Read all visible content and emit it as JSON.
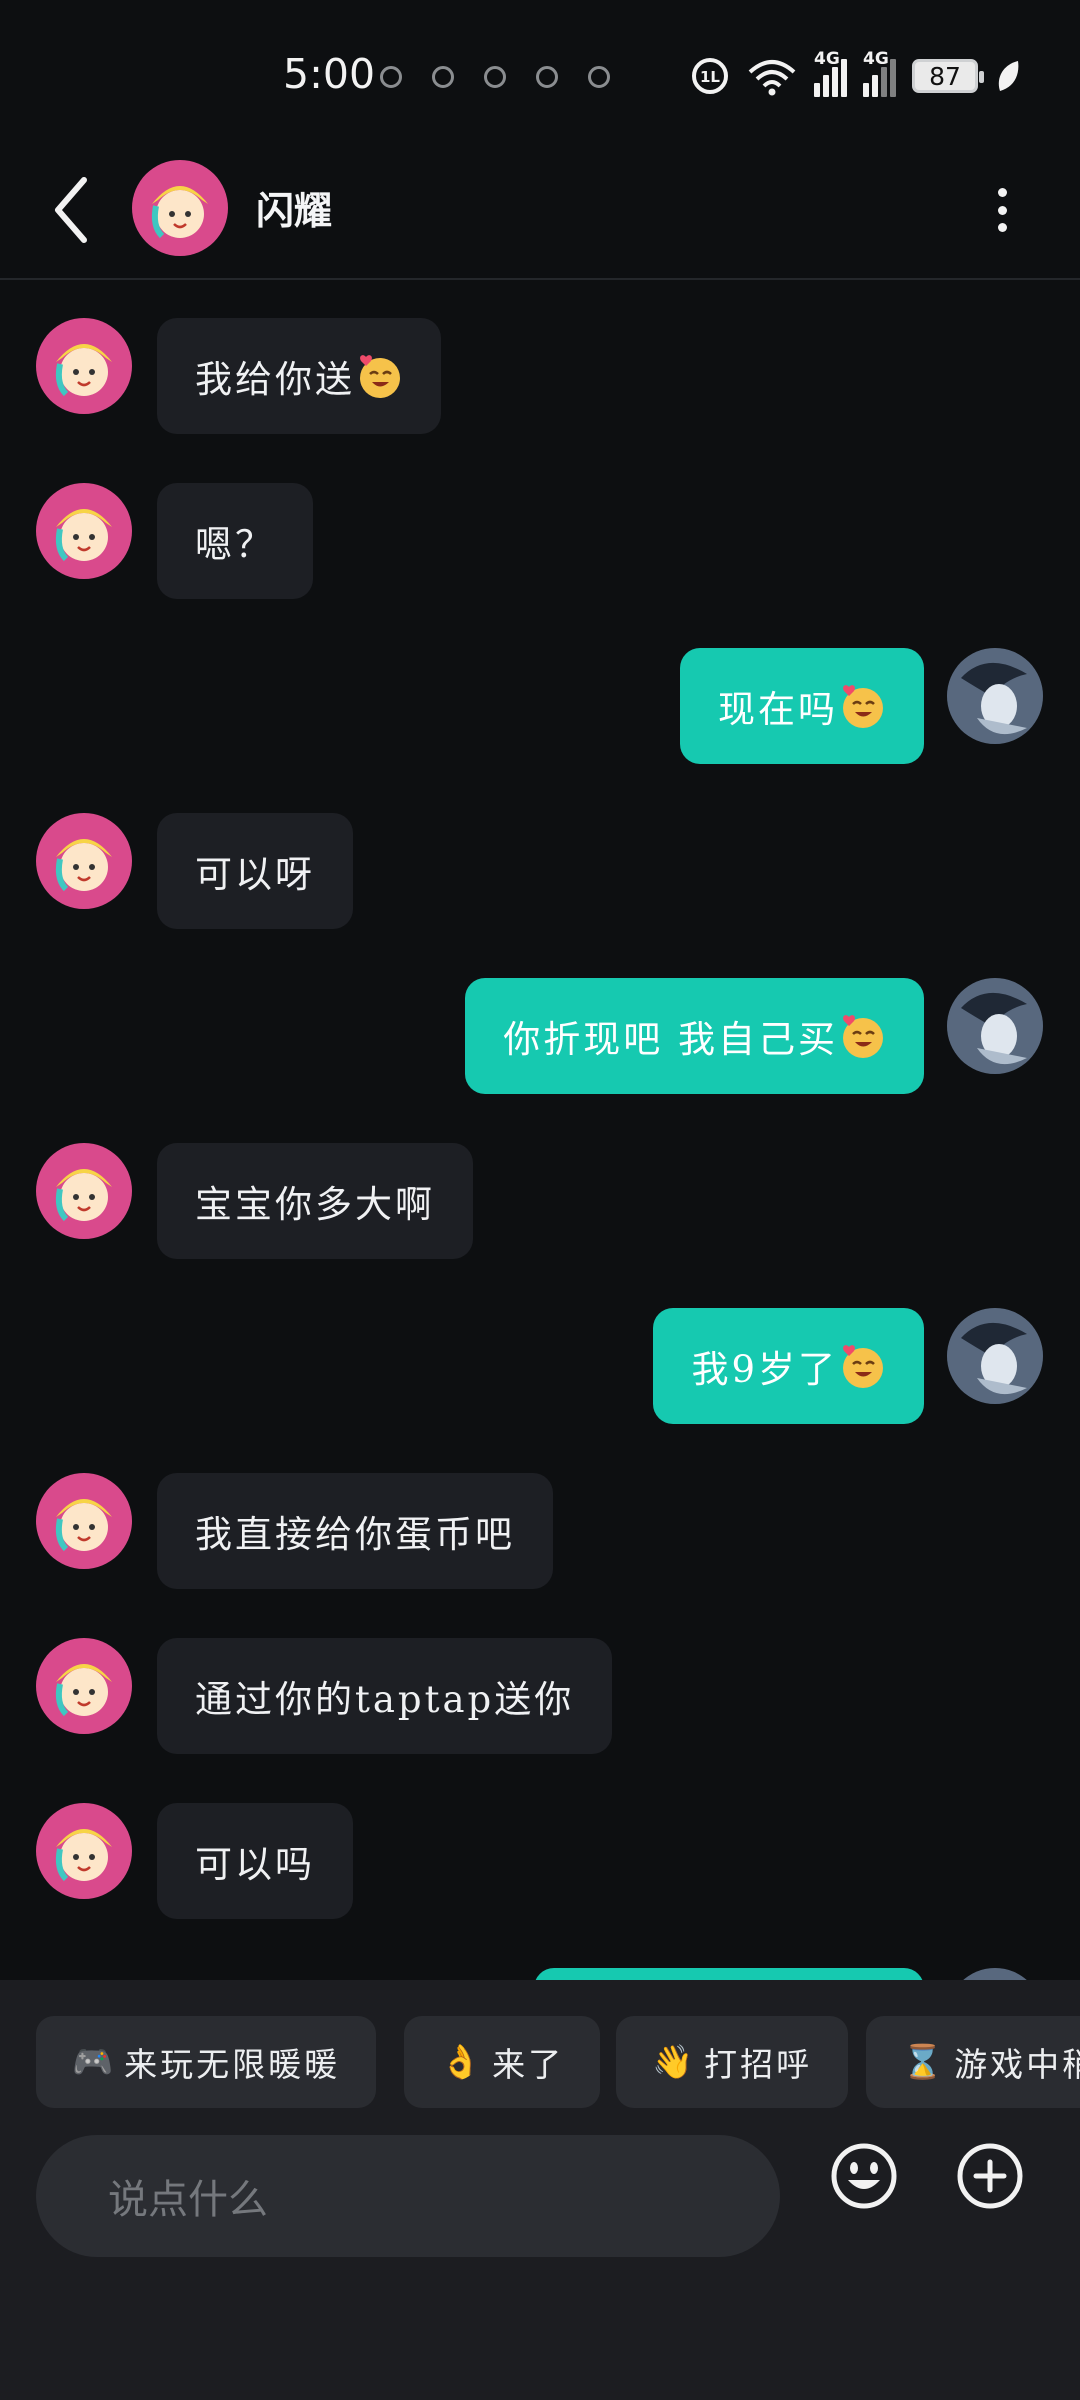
{
  "status_bar": {
    "time": "5:00",
    "network_1": "4G",
    "network_2": "4G",
    "battery": "87"
  },
  "header": {
    "contact_name": "闪耀"
  },
  "messages": [
    {
      "side": "in",
      "text": "我给你送",
      "emoji": "kissing-heart"
    },
    {
      "side": "in",
      "text": "嗯？",
      "emoji": ""
    },
    {
      "side": "out",
      "text": "现在吗",
      "emoji": "kissing-heart"
    },
    {
      "side": "in",
      "text": "可以呀",
      "emoji": ""
    },
    {
      "side": "out",
      "text": "你折现吧 我自己买",
      "emoji": "kissing-heart"
    },
    {
      "side": "in",
      "text": "宝宝你多大啊",
      "emoji": ""
    },
    {
      "side": "out",
      "text": "我9岁了",
      "emoji": "kissing-heart"
    },
    {
      "side": "in",
      "text": "我直接给你蛋币吧",
      "emoji": ""
    },
    {
      "side": "in",
      "text": "通过你的taptap送你",
      "emoji": ""
    },
    {
      "side": "in",
      "text": "可以吗",
      "emoji": ""
    }
  ],
  "quick_replies": [
    {
      "icon": "🎮",
      "label": " 来玩无限暖暖"
    },
    {
      "icon": "👌",
      "label": "来了"
    },
    {
      "icon": "👋",
      "label": "打招呼"
    },
    {
      "icon": "⌛",
      "label": "游戏中稍"
    }
  ],
  "input": {
    "placeholder": "说点什么"
  },
  "colors": {
    "background": "#0d0f11",
    "incoming_bubble": "#1d1f24",
    "outgoing_bubble": "#16c9b0",
    "panel": "#1c1d21"
  }
}
